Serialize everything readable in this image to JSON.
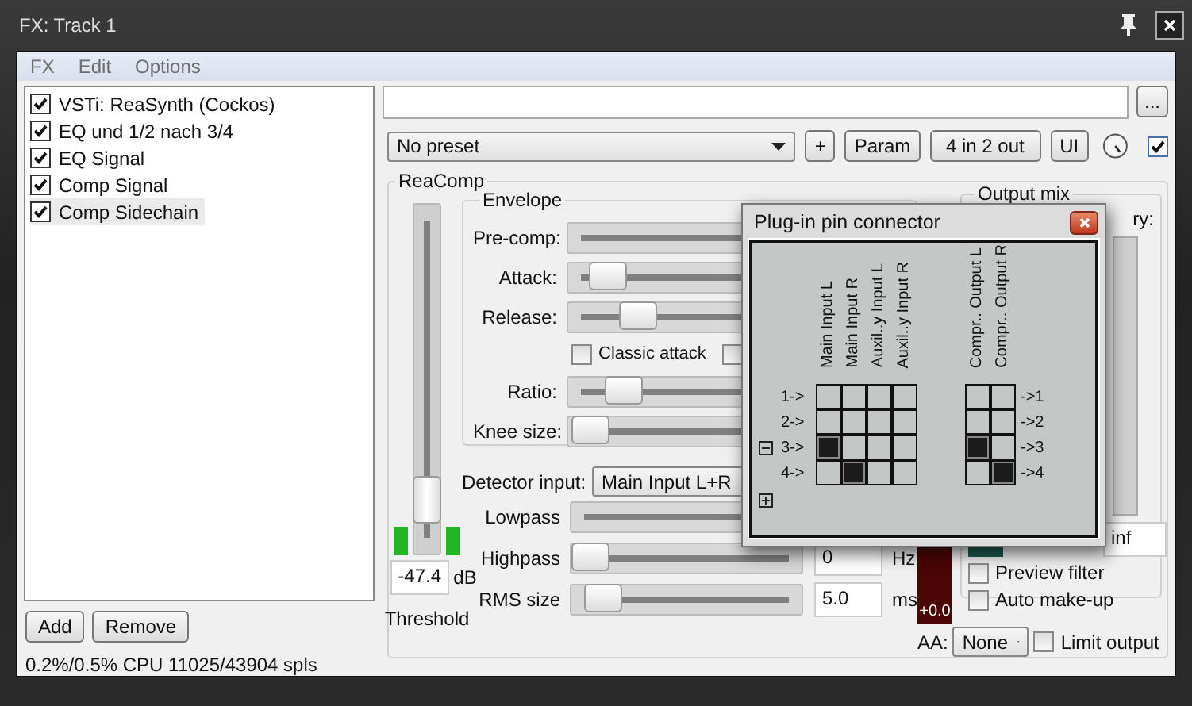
{
  "window": {
    "title": "FX: Track 1"
  },
  "menu": [
    "FX",
    "Edit",
    "Options"
  ],
  "fx_chain": [
    {
      "label": "VSTi: ReaSynth (Cockos)",
      "checked": true,
      "selected": false
    },
    {
      "label": "EQ und 1/2 nach 3/4",
      "checked": true,
      "selected": false
    },
    {
      "label": "EQ Signal",
      "checked": true,
      "selected": false
    },
    {
      "label": "Comp Signal",
      "checked": true,
      "selected": false
    },
    {
      "label": "Comp Sidechain",
      "checked": true,
      "selected": true
    }
  ],
  "chain_buttons": [
    "Add",
    "Remove"
  ],
  "cpu_status": "0.2%/0.5% CPU 11025/43904 spls",
  "browse_button": "...",
  "preset": "No preset",
  "toolbar_buttons": [
    "+",
    "Param",
    "4 in 2 out",
    "UI"
  ],
  "plugin_enabled": {
    "checked": true
  },
  "plugin": {
    "title": "ReaComp",
    "threshold": {
      "level": 0.1,
      "value": "-47.4",
      "unit": "dB",
      "label": "Threshold"
    },
    "envelope": {
      "title": "Envelope",
      "rows": [
        {
          "kind": "slider",
          "label": "Pre-comp:"
        },
        {
          "kind": "slider",
          "label": "Attack:",
          "level": 0.07
        },
        {
          "kind": "slider",
          "label": "Release:",
          "level": 0.17
        },
        {
          "kind": "checkboxes",
          "items": [
            {
              "label": "Classic attack",
              "checked": false
            },
            {
              "checked": false
            }
          ]
        },
        {
          "kind": "slider",
          "label": "Ratio:",
          "level": 0.12
        },
        {
          "kind": "slider",
          "label": "Knee size:",
          "level": 0.01
        }
      ]
    },
    "detector": {
      "label": "Detector input:",
      "value": "Main Input L+R"
    },
    "filters": [
      {
        "label": "Lowpass"
      },
      {
        "label": "Highpass",
        "level": 0,
        "value": "0",
        "unit": "Hz"
      },
      {
        "label": "RMS size",
        "level": 0.07,
        "value": "5.0",
        "unit": "ms"
      }
    ],
    "output": {
      "meter_reading": "+0.0",
      "title": "Output mix",
      "cut_label": "ry:",
      "field": "inf",
      "checkboxes": [
        {
          "label": "Preview filter",
          "checked": false
        },
        {
          "label": "Auto make-up",
          "checked": false
        }
      ],
      "aa": {
        "label": "AA:",
        "value": "None"
      },
      "limit_output": {
        "label": "Limit output",
        "checked": false
      }
    }
  },
  "pin_connector": {
    "title": "Plug-in pin connector",
    "inputs": [
      "Main Input L",
      "Main Input R",
      "Auxil..y Input L",
      "Auxil..y Input R"
    ],
    "outputs": [
      "Compr.. Output L",
      "Compr.. Output R"
    ],
    "input_rows": [
      "1->",
      "2->",
      "3->",
      "4->"
    ],
    "output_rows": [
      "->1",
      "->2",
      "->3",
      "->4"
    ],
    "input_pins": [
      [
        false,
        false,
        false,
        false
      ],
      [
        false,
        false,
        false,
        false
      ],
      [
        true,
        false,
        false,
        false
      ],
      [
        false,
        true,
        false,
        false
      ]
    ],
    "output_pins": [
      [
        false,
        false
      ],
      [
        false,
        false
      ],
      [
        true,
        false
      ],
      [
        false,
        true
      ]
    ]
  }
}
